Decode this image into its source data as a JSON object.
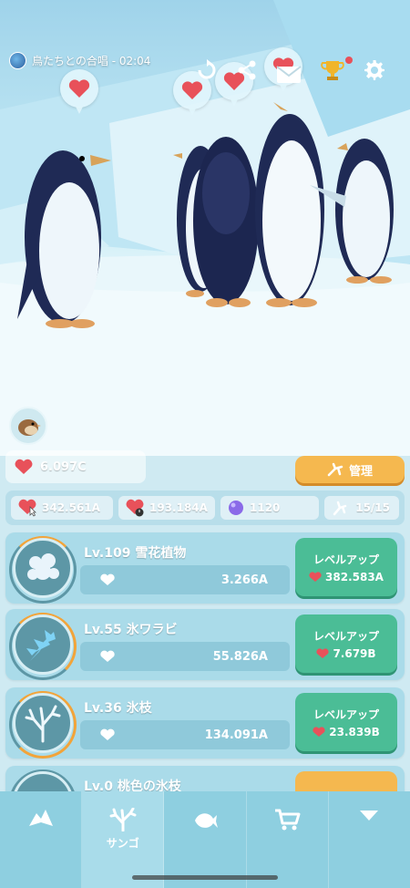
{
  "header": {
    "title": "鳥たちとの合唱 - 02:04"
  },
  "icons": {
    "globe": "globe-icon",
    "reset": "rotate-icon",
    "share": "share-icon",
    "mail": "mail-icon",
    "trophy": "trophy-icon",
    "settings": "gear-icon"
  },
  "currency": {
    "hearts": "6.097C",
    "manage_label": "管理"
  },
  "stats": {
    "hearts_per_tap": "342.561A",
    "hearts_per_sec": "193.184A",
    "orbs": "1120",
    "coral_count": "15/15"
  },
  "corals": [
    {
      "name": "Lv.109 雪花植物",
      "value": "3.266A",
      "button": "レベルアップ",
      "cost": "382.583A",
      "progress": 0.15
    },
    {
      "name": "Lv.55 氷ワラビ",
      "value": "55.826A",
      "button": "レベルアップ",
      "cost": "7.679B",
      "progress": 0.3
    },
    {
      "name": "Lv.36 氷枝",
      "value": "134.091A",
      "button": "レベルアップ",
      "cost": "23.839B",
      "progress": 0.55
    },
    {
      "name": "Lv.0 桃色の氷枝",
      "value": "",
      "button": "",
      "cost": "",
      "progress": 0
    }
  ],
  "nav": {
    "tabs": [
      {
        "icon": "iceberg-icon",
        "label": ""
      },
      {
        "icon": "coral-icon",
        "label": "サンゴ"
      },
      {
        "icon": "fish-icon",
        "label": ""
      },
      {
        "icon": "cart-icon",
        "label": ""
      },
      {
        "icon": "triangle-down-icon",
        "label": ""
      }
    ]
  },
  "colors": {
    "heart": "#e8515a",
    "green_button": "#4bbd96",
    "orange_button": "#f5b84f",
    "ring_orange": "#f2a43a"
  }
}
